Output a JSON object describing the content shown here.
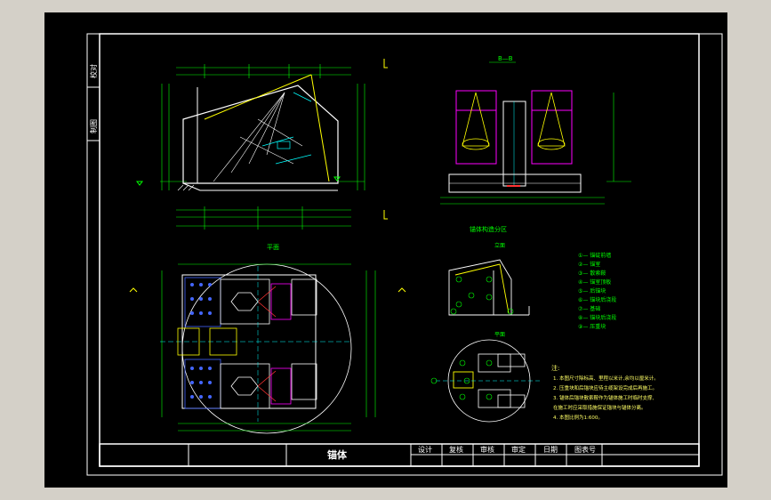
{
  "window": {
    "viewport_bg": "#000000",
    "chrome_bg": "#d4d0c8"
  },
  "title_block": {
    "drawing_name": "锚体",
    "labels": [
      "设计",
      "复核",
      "审核",
      "审定",
      "日期",
      "图表号"
    ]
  },
  "side_stamp": {
    "labels": [
      "校对",
      "制图"
    ]
  },
  "views": {
    "section_title": "B—B",
    "top_view_title": "平面",
    "detail_title": "锚体构造分区",
    "detail_front": "立面",
    "detail_plan": "平面"
  },
  "components": {
    "legend": [
      "①— 锚碇前墙",
      "②— 锚室",
      "③— 散索鞍",
      "④— 锚室顶板",
      "⑤— 后锚块",
      "⑥— 锚块后浇段",
      "⑦— 基础",
      "⑧— 锚块后浇段",
      "⑨— 压重块"
    ]
  },
  "notes": {
    "heading": "注:",
    "items": [
      "1. 本图尺寸除标高、里程以米计,余均以厘米计。",
      "2. 压重块和后锚块应待主缆架设完成后再施工。",
      "3. 锚体后锚块散索鞍作为锚体施工时临时支撑,",
      "   在施工时应采取措施保证锚块与锚体分离。",
      "4. 本图比例为1:600。"
    ]
  },
  "colors": {
    "frame": "#ffffff",
    "dims": "#00ff00",
    "body": "#ffffff",
    "accent_yellow": "#ffff00",
    "accent_magenta": "#ff00ff",
    "accent_cyan": "#00ffff",
    "accent_red": "#ff3333"
  }
}
